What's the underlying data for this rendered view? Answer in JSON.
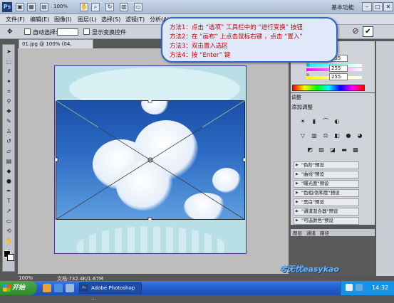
{
  "titlebar": {
    "logo": "Ps",
    "zoom": "100%",
    "workspace": "基本功能",
    "window_buttons": [
      "–",
      "□",
      "✕"
    ]
  },
  "menubar": {
    "items": [
      "文件(F)",
      "编辑(E)",
      "图像(I)",
      "图层(L)",
      "选择(S)",
      "滤镜(T)",
      "分析(A)"
    ]
  },
  "options": {
    "auto_select_label": "自动选择:",
    "show_transform_label": "显示变换控件",
    "cancel_label": "⊘",
    "commit_label": "✔"
  },
  "callout": {
    "steps": [
      "方法1：点击 “选项” 工具栏中的 “进行变换” 按钮",
      "方法2：在 “画布” 上点击鼠标右键 ，点击 “置入”",
      "方法3：双击置入选区",
      "方法4：按 “Enter” 键"
    ]
  },
  "document": {
    "tab_title": "01.jpg @ 100% (04, RGB/8#)",
    "status_zoom": "100%",
    "status_doc": "文档:732.4K/1.67M"
  },
  "color_panel": {
    "r_value": "255",
    "g_value": "255",
    "b_value": "255",
    "r_key": "R",
    "g_key": "G",
    "b_key": "B"
  },
  "adjustments": {
    "tab_label": "调整",
    "title": "添加调整",
    "presets": [
      "\"色阶\"预设",
      "\"曲线\"预设",
      "\"曝光度\"预设",
      "\"色相/饱和度\"预设",
      "\"黑白\"预设",
      "\"通道混合器\"预设",
      "\"可选颜色\"预设"
    ]
  },
  "layers_tabs": [
    "图层",
    "通道",
    "路径"
  ],
  "taskbar": {
    "start_label": "开始",
    "app_label": "Adobe Photoshop ...",
    "app_icon": "Ps",
    "clock": "14:32"
  },
  "watermark": "考无忧easykao",
  "colors": {
    "accent_red": "#c80000",
    "callout_border": "#2c67c9",
    "taskbar_blue": "#245fd0"
  }
}
